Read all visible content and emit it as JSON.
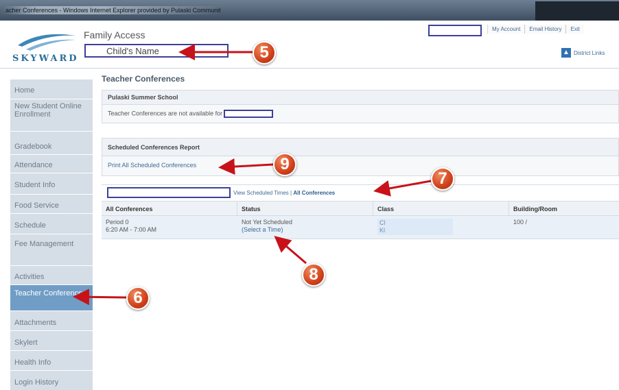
{
  "window": {
    "title": "acher Conferences - Windows Internet Explorer provided by Pulaski Communit"
  },
  "header": {
    "logo_text": "SKYWARD",
    "app_title": "Family Access",
    "child_name": "Child's Name",
    "links": [
      "My Account",
      "Email History",
      "Exit"
    ],
    "district_link": "District Links"
  },
  "sidebar": {
    "items": [
      {
        "label": "Home"
      },
      {
        "label": "New Student Online Enrollment"
      },
      {
        "label": "Gradebook"
      },
      {
        "label": "Attendance"
      },
      {
        "label": "Student Info"
      },
      {
        "label": "Food Service"
      },
      {
        "label": "Schedule"
      },
      {
        "label": "Fee Management"
      },
      {
        "label": "Activities"
      },
      {
        "label": "Teacher Conferences"
      },
      {
        "label": "Attachments"
      },
      {
        "label": "Skylert"
      },
      {
        "label": "Health Info"
      },
      {
        "label": "Login History"
      }
    ]
  },
  "main": {
    "title": "Teacher Conferences",
    "school_panel": {
      "heading": "Pulaski Summer School",
      "message": "Teacher Conferences are not available for"
    },
    "report_panel": {
      "heading": "Scheduled Conferences Report",
      "link": "Print All Scheduled Conferences"
    },
    "table": {
      "view_link": "View Scheduled Times",
      "separator": "|",
      "all_link": "All Conferences",
      "headers": [
        "All Conferences",
        "Status",
        "Class",
        "Building/Room"
      ],
      "rows": [
        {
          "period": "Period 0",
          "time": "6:20 AM - 7:00 AM",
          "status": "Not Yet Scheduled",
          "status_link": "(Select a Time)",
          "class_line1": "Cl",
          "class_line2": "Kl",
          "room": "100 /"
        }
      ]
    }
  },
  "annotations": {
    "badge_5": "5",
    "badge_6": "6",
    "badge_7": "7",
    "badge_8": "8",
    "badge_9": "9",
    "arrow_color": "#c8121a"
  }
}
